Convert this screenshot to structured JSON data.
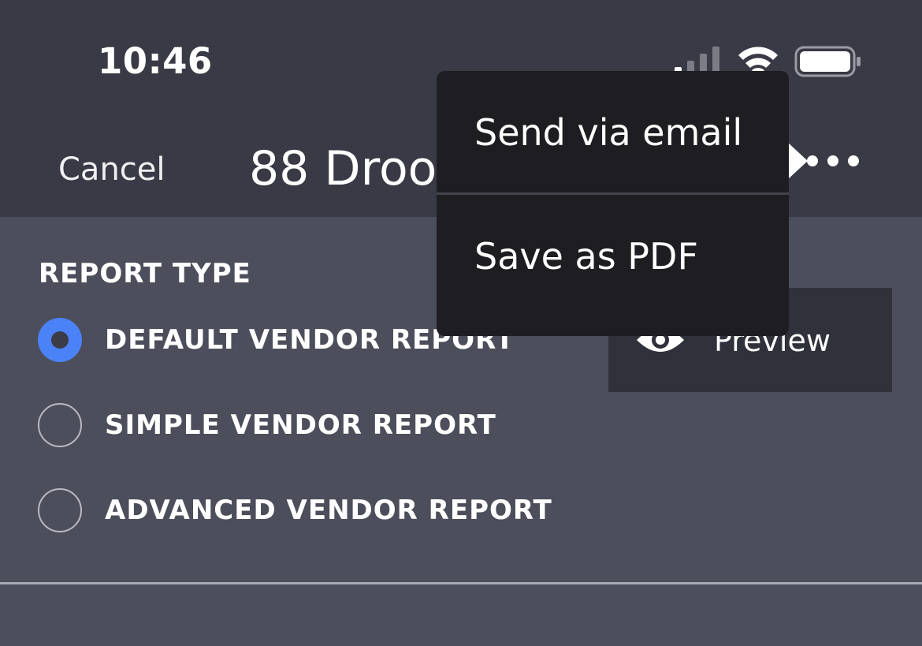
{
  "status_bar": {
    "time": "10:46",
    "signal_icon": "cellular-signal-icon",
    "wifi_icon": "wifi-icon",
    "battery_icon": "battery-icon"
  },
  "header": {
    "cancel_label": "Cancel",
    "title": "88 Droo",
    "more_icon": "more-horizontal-icon"
  },
  "report_type": {
    "heading": "REPORT TYPE",
    "options": [
      {
        "label": "DEFAULT VENDOR REPORT",
        "selected": true
      },
      {
        "label": "SIMPLE VENDOR REPORT",
        "selected": false
      },
      {
        "label": "ADVANCED VENDOR REPORT",
        "selected": false
      }
    ]
  },
  "preview": {
    "label": "Preview",
    "icon": "eye-icon"
  },
  "menu": {
    "items": [
      {
        "label": "Send via email"
      },
      {
        "label": "Save as PDF"
      }
    ]
  },
  "colors": {
    "accent": "#4c82f7",
    "background": "#4d4e5b",
    "topbar": "#393a45",
    "menu": "#1d1d22"
  }
}
